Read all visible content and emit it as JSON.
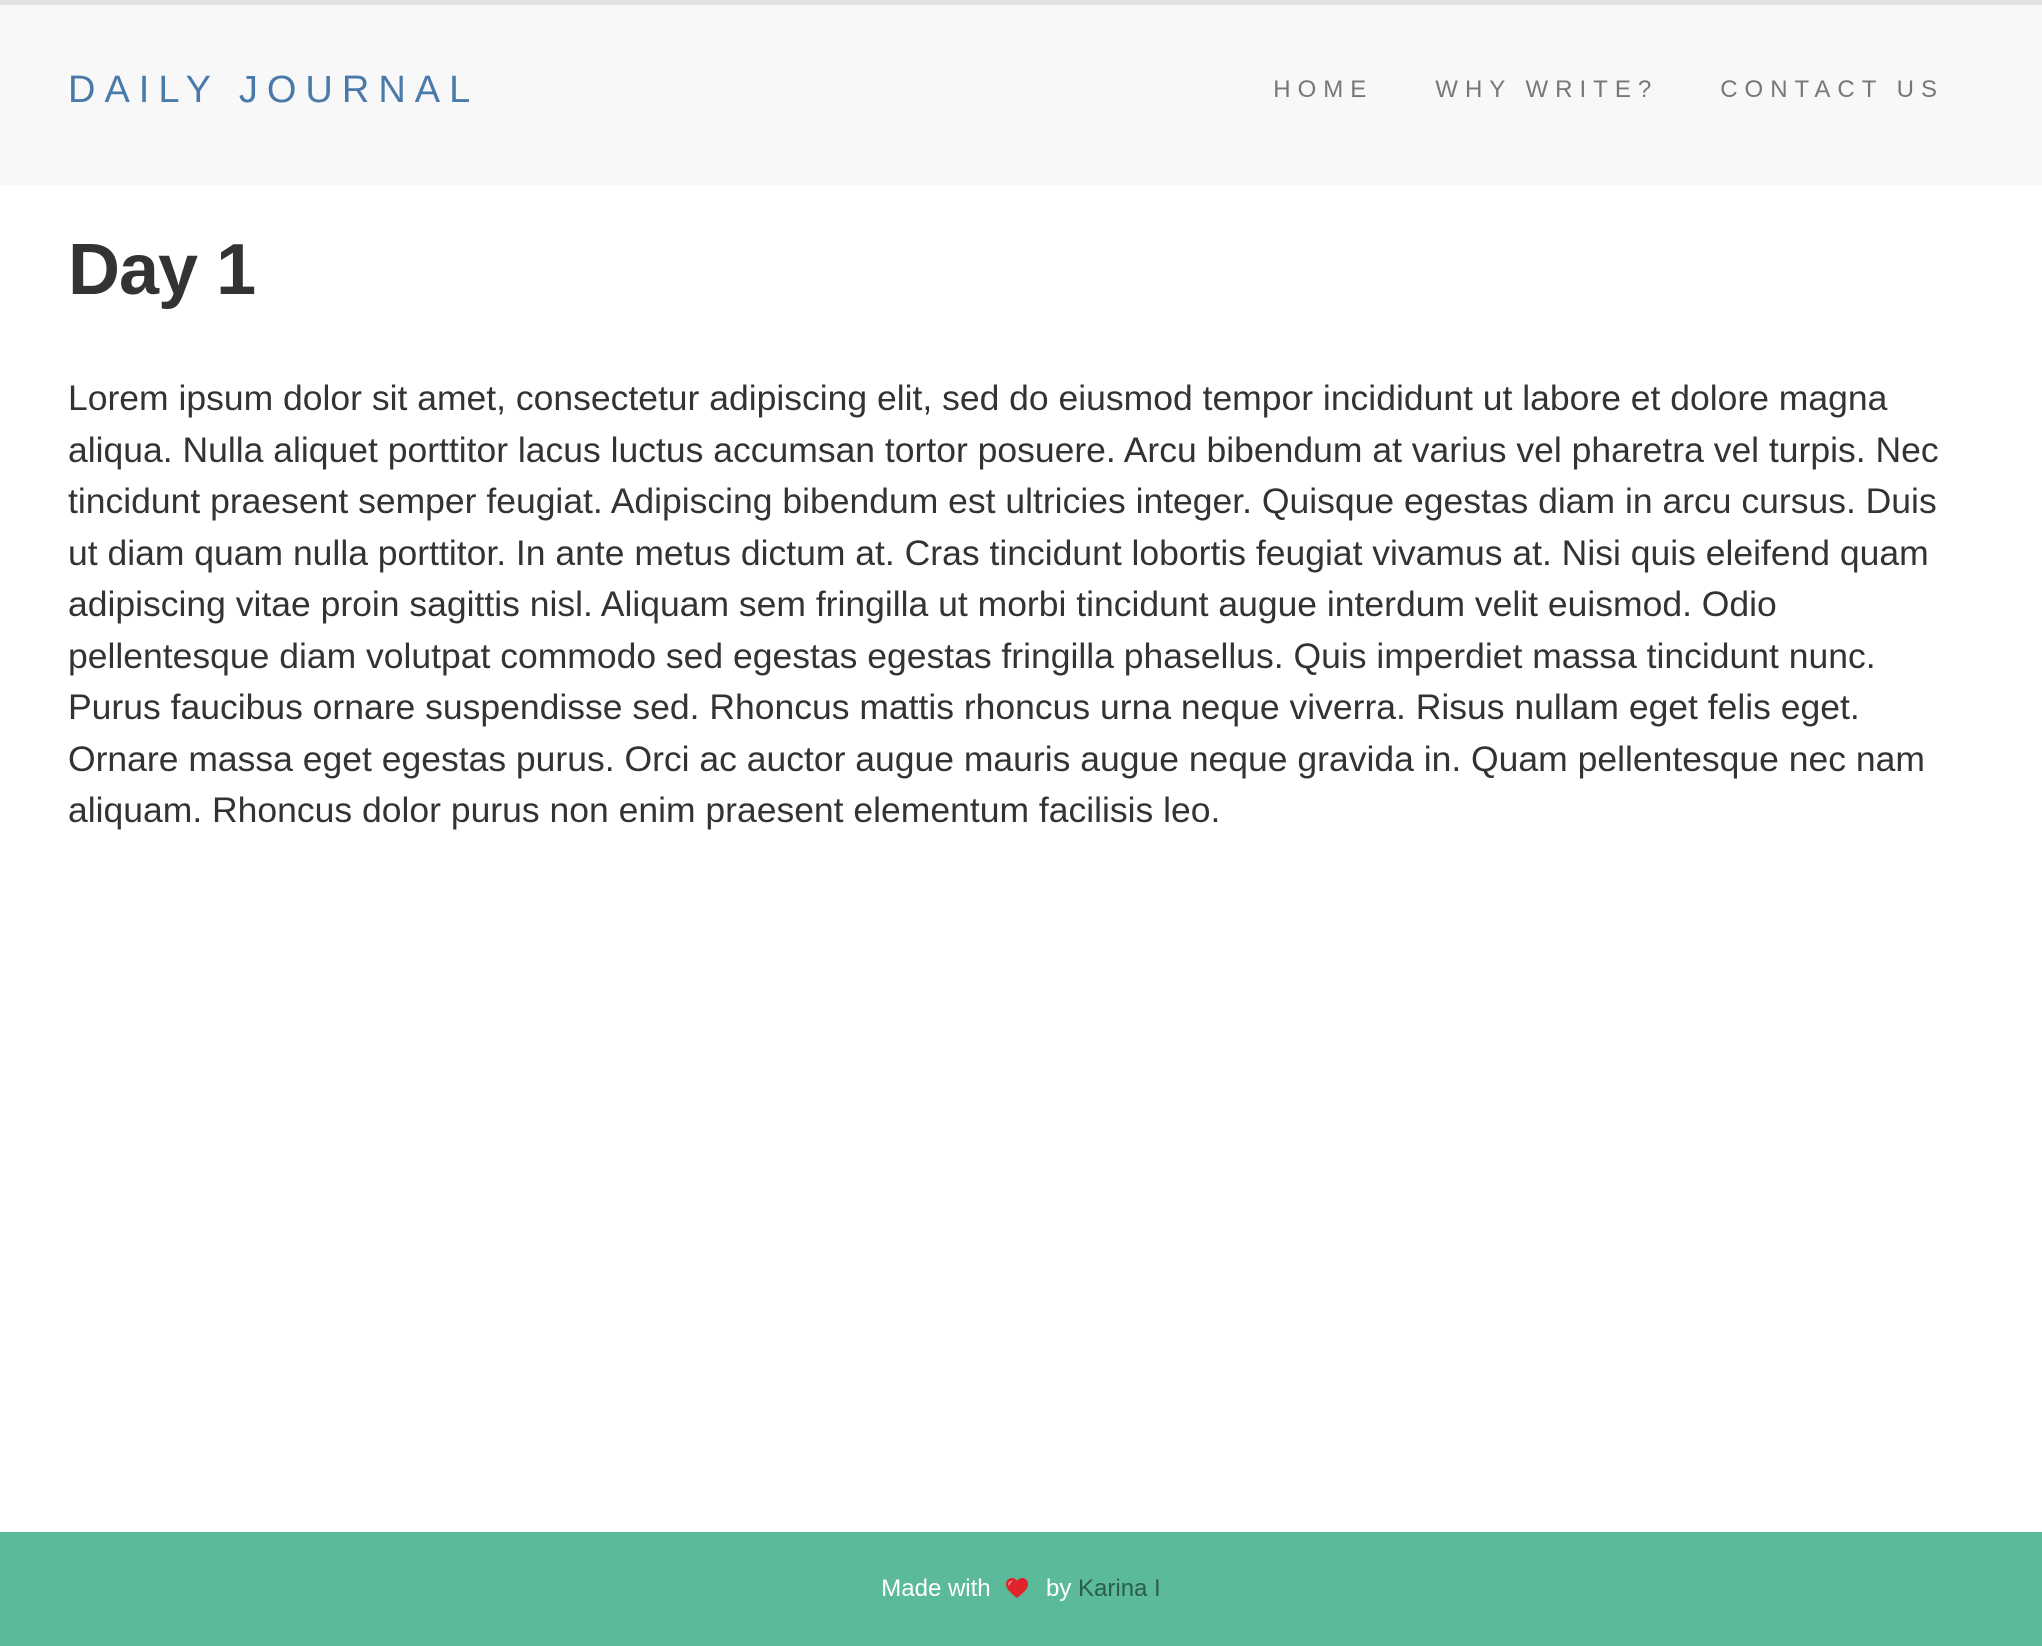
{
  "navbar": {
    "brand": "DAILY JOURNAL",
    "links": [
      {
        "label": "HOME"
      },
      {
        "label": "WHY WRITE?"
      },
      {
        "label": "CONTACT US"
      }
    ]
  },
  "post": {
    "title": "Day 1",
    "body": "Lorem ipsum dolor sit amet, consectetur adipiscing elit, sed do eiusmod tempor incididunt ut labore et dolore magna aliqua. Nulla aliquet porttitor lacus luctus accumsan tortor posuere. Arcu bibendum at varius vel pharetra vel turpis. Nec tincidunt praesent semper feugiat. Adipiscing bibendum est ultricies integer. Quisque egestas diam in arcu cursus. Duis ut diam quam nulla porttitor. In ante metus dictum at. Cras tincidunt lobortis feugiat vivamus at. Nisi quis eleifend quam adipiscing vitae proin sagittis nisl. Aliquam sem fringilla ut morbi tincidunt augue interdum velit euismod. Odio pellentesque diam volutpat commodo sed egestas egestas fringilla phasellus. Quis imperdiet massa tincidunt nunc. Purus faucibus ornare suspendisse sed. Rhoncus mattis rhoncus urna neque viverra. Risus nullam eget felis eget. Ornare massa eget egestas purus. Orci ac auctor augue mauris augue neque gravida in. Quam pellentesque nec nam aliquam. Rhoncus dolor purus non enim praesent elementum facilisis leo."
  },
  "footer": {
    "made_with": "Made with",
    "heart_icon": "heart-icon",
    "by": "by",
    "author": "Karina I"
  },
  "colors": {
    "brand": "#4a7aa9",
    "navbar_bg": "#f8f8f8",
    "nav_link": "#777777",
    "text": "#333333",
    "footer_bg": "#5bba9a",
    "footer_author": "#2d5e4a",
    "heart": "#e0242b"
  }
}
